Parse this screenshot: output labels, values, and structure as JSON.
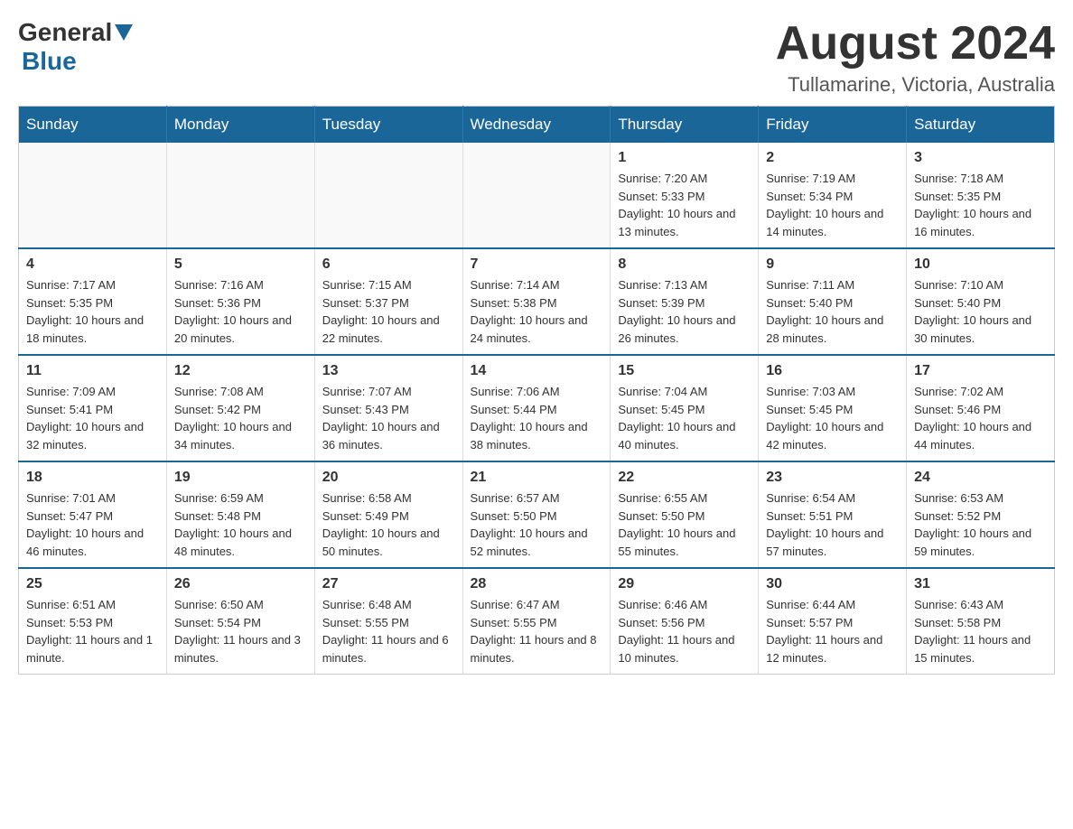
{
  "header": {
    "logo_general": "General",
    "logo_blue": "Blue",
    "month_title": "August 2024",
    "location": "Tullamarine, Victoria, Australia"
  },
  "weekdays": [
    "Sunday",
    "Monday",
    "Tuesday",
    "Wednesday",
    "Thursday",
    "Friday",
    "Saturday"
  ],
  "rows": [
    [
      {
        "day": "",
        "sunrise": "",
        "sunset": "",
        "daylight": ""
      },
      {
        "day": "",
        "sunrise": "",
        "sunset": "",
        "daylight": ""
      },
      {
        "day": "",
        "sunrise": "",
        "sunset": "",
        "daylight": ""
      },
      {
        "day": "",
        "sunrise": "",
        "sunset": "",
        "daylight": ""
      },
      {
        "day": "1",
        "sunrise": "Sunrise: 7:20 AM",
        "sunset": "Sunset: 5:33 PM",
        "daylight": "Daylight: 10 hours and 13 minutes."
      },
      {
        "day": "2",
        "sunrise": "Sunrise: 7:19 AM",
        "sunset": "Sunset: 5:34 PM",
        "daylight": "Daylight: 10 hours and 14 minutes."
      },
      {
        "day": "3",
        "sunrise": "Sunrise: 7:18 AM",
        "sunset": "Sunset: 5:35 PM",
        "daylight": "Daylight: 10 hours and 16 minutes."
      }
    ],
    [
      {
        "day": "4",
        "sunrise": "Sunrise: 7:17 AM",
        "sunset": "Sunset: 5:35 PM",
        "daylight": "Daylight: 10 hours and 18 minutes."
      },
      {
        "day": "5",
        "sunrise": "Sunrise: 7:16 AM",
        "sunset": "Sunset: 5:36 PM",
        "daylight": "Daylight: 10 hours and 20 minutes."
      },
      {
        "day": "6",
        "sunrise": "Sunrise: 7:15 AM",
        "sunset": "Sunset: 5:37 PM",
        "daylight": "Daylight: 10 hours and 22 minutes."
      },
      {
        "day": "7",
        "sunrise": "Sunrise: 7:14 AM",
        "sunset": "Sunset: 5:38 PM",
        "daylight": "Daylight: 10 hours and 24 minutes."
      },
      {
        "day": "8",
        "sunrise": "Sunrise: 7:13 AM",
        "sunset": "Sunset: 5:39 PM",
        "daylight": "Daylight: 10 hours and 26 minutes."
      },
      {
        "day": "9",
        "sunrise": "Sunrise: 7:11 AM",
        "sunset": "Sunset: 5:40 PM",
        "daylight": "Daylight: 10 hours and 28 minutes."
      },
      {
        "day": "10",
        "sunrise": "Sunrise: 7:10 AM",
        "sunset": "Sunset: 5:40 PM",
        "daylight": "Daylight: 10 hours and 30 minutes."
      }
    ],
    [
      {
        "day": "11",
        "sunrise": "Sunrise: 7:09 AM",
        "sunset": "Sunset: 5:41 PM",
        "daylight": "Daylight: 10 hours and 32 minutes."
      },
      {
        "day": "12",
        "sunrise": "Sunrise: 7:08 AM",
        "sunset": "Sunset: 5:42 PM",
        "daylight": "Daylight: 10 hours and 34 minutes."
      },
      {
        "day": "13",
        "sunrise": "Sunrise: 7:07 AM",
        "sunset": "Sunset: 5:43 PM",
        "daylight": "Daylight: 10 hours and 36 minutes."
      },
      {
        "day": "14",
        "sunrise": "Sunrise: 7:06 AM",
        "sunset": "Sunset: 5:44 PM",
        "daylight": "Daylight: 10 hours and 38 minutes."
      },
      {
        "day": "15",
        "sunrise": "Sunrise: 7:04 AM",
        "sunset": "Sunset: 5:45 PM",
        "daylight": "Daylight: 10 hours and 40 minutes."
      },
      {
        "day": "16",
        "sunrise": "Sunrise: 7:03 AM",
        "sunset": "Sunset: 5:45 PM",
        "daylight": "Daylight: 10 hours and 42 minutes."
      },
      {
        "day": "17",
        "sunrise": "Sunrise: 7:02 AM",
        "sunset": "Sunset: 5:46 PM",
        "daylight": "Daylight: 10 hours and 44 minutes."
      }
    ],
    [
      {
        "day": "18",
        "sunrise": "Sunrise: 7:01 AM",
        "sunset": "Sunset: 5:47 PM",
        "daylight": "Daylight: 10 hours and 46 minutes."
      },
      {
        "day": "19",
        "sunrise": "Sunrise: 6:59 AM",
        "sunset": "Sunset: 5:48 PM",
        "daylight": "Daylight: 10 hours and 48 minutes."
      },
      {
        "day": "20",
        "sunrise": "Sunrise: 6:58 AM",
        "sunset": "Sunset: 5:49 PM",
        "daylight": "Daylight: 10 hours and 50 minutes."
      },
      {
        "day": "21",
        "sunrise": "Sunrise: 6:57 AM",
        "sunset": "Sunset: 5:50 PM",
        "daylight": "Daylight: 10 hours and 52 minutes."
      },
      {
        "day": "22",
        "sunrise": "Sunrise: 6:55 AM",
        "sunset": "Sunset: 5:50 PM",
        "daylight": "Daylight: 10 hours and 55 minutes."
      },
      {
        "day": "23",
        "sunrise": "Sunrise: 6:54 AM",
        "sunset": "Sunset: 5:51 PM",
        "daylight": "Daylight: 10 hours and 57 minutes."
      },
      {
        "day": "24",
        "sunrise": "Sunrise: 6:53 AM",
        "sunset": "Sunset: 5:52 PM",
        "daylight": "Daylight: 10 hours and 59 minutes."
      }
    ],
    [
      {
        "day": "25",
        "sunrise": "Sunrise: 6:51 AM",
        "sunset": "Sunset: 5:53 PM",
        "daylight": "Daylight: 11 hours and 1 minute."
      },
      {
        "day": "26",
        "sunrise": "Sunrise: 6:50 AM",
        "sunset": "Sunset: 5:54 PM",
        "daylight": "Daylight: 11 hours and 3 minutes."
      },
      {
        "day": "27",
        "sunrise": "Sunrise: 6:48 AM",
        "sunset": "Sunset: 5:55 PM",
        "daylight": "Daylight: 11 hours and 6 minutes."
      },
      {
        "day": "28",
        "sunrise": "Sunrise: 6:47 AM",
        "sunset": "Sunset: 5:55 PM",
        "daylight": "Daylight: 11 hours and 8 minutes."
      },
      {
        "day": "29",
        "sunrise": "Sunrise: 6:46 AM",
        "sunset": "Sunset: 5:56 PM",
        "daylight": "Daylight: 11 hours and 10 minutes."
      },
      {
        "day": "30",
        "sunrise": "Sunrise: 6:44 AM",
        "sunset": "Sunset: 5:57 PM",
        "daylight": "Daylight: 11 hours and 12 minutes."
      },
      {
        "day": "31",
        "sunrise": "Sunrise: 6:43 AM",
        "sunset": "Sunset: 5:58 PM",
        "daylight": "Daylight: 11 hours and 15 minutes."
      }
    ]
  ]
}
